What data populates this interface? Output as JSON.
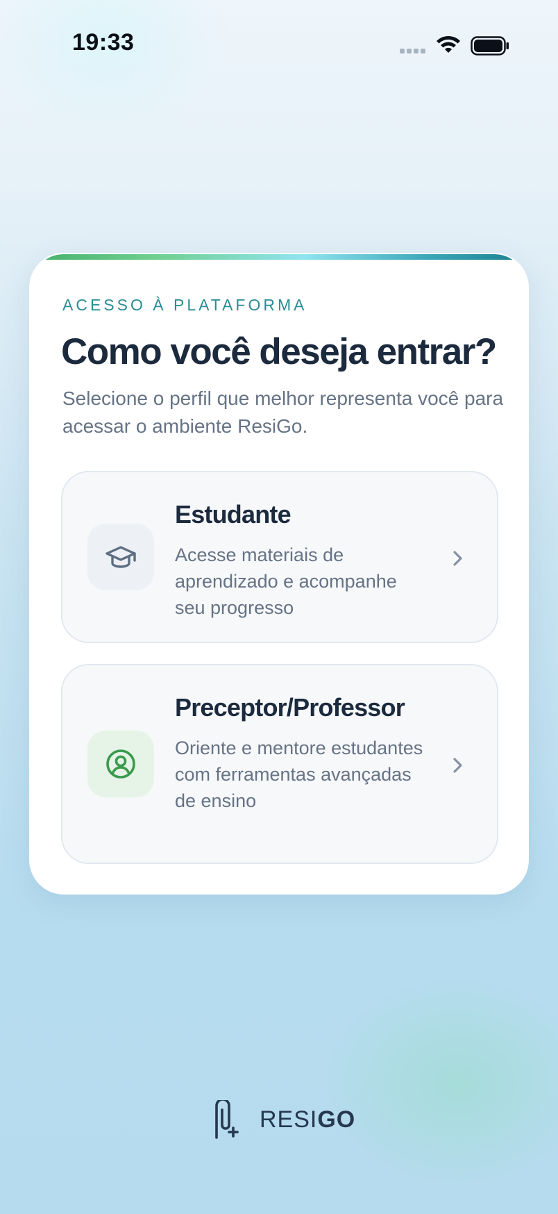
{
  "status_bar": {
    "time": "19:33",
    "icons": [
      "signal-dots-icon",
      "wifi-icon",
      "battery-icon"
    ]
  },
  "card": {
    "eyebrow": "ACESSO À PLATAFORMA",
    "title": "Como você deseja entrar?",
    "subtitle": "Selecione o perfil que melhor representa você para acessar o ambiente ResiGo.",
    "options": [
      {
        "title": "Estudante",
        "description": "Acesse materiais de aprendizado e acompanhe seu progresso",
        "icon": "graduation-cap-icon"
      },
      {
        "title": "Preceptor/Professor",
        "description": "Oriente e mentore estudantes com ferramentas avançadas de ensino",
        "icon": "user-circle-icon"
      }
    ]
  },
  "brand": {
    "logo_text": "RESIGO",
    "icon": "resigo-logo-icon"
  },
  "colors": {
    "accent_teal": "#2a8d94",
    "accent_green": "#3a9a4c",
    "title": "#1c2a3e",
    "muted": "#667385"
  }
}
